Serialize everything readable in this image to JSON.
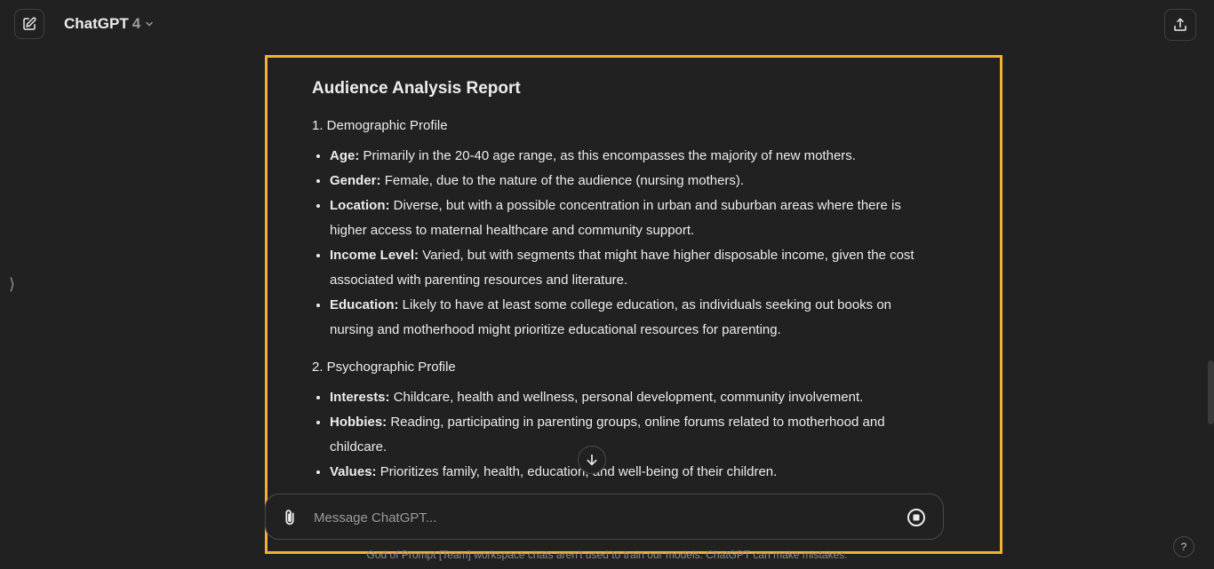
{
  "header": {
    "model_name": "ChatGPT",
    "model_version": "4"
  },
  "icons": {
    "new_chat": "pencil-square-icon",
    "model_dropdown": "chevron-down-icon",
    "share": "share-upload-icon",
    "sidebar_toggle": "chevron-right-icon",
    "scroll_down": "arrow-down-icon",
    "attach": "paperclip-icon",
    "stop": "stop-circle-icon"
  },
  "sidebar_toggle_glyph": "⟩",
  "report": {
    "title": "Audience Analysis Report",
    "sections": [
      {
        "heading": "1. Demographic Profile",
        "items": [
          {
            "label": "Age:",
            "text": "Primarily in the 20-40 age range, as this encompasses the majority of new mothers."
          },
          {
            "label": "Gender:",
            "text": "Female, due to the nature of the audience (nursing mothers)."
          },
          {
            "label": "Location:",
            "text": "Diverse, but with a possible concentration in urban and suburban areas where there is higher access to maternal healthcare and community support."
          },
          {
            "label": "Income Level:",
            "text": "Varied, but with segments that might have higher disposable income, given the cost associated with parenting resources and literature."
          },
          {
            "label": "Education:",
            "text": "Likely to have at least some college education, as individuals seeking out books on nursing and motherhood might prioritize educational resources for parenting."
          }
        ]
      },
      {
        "heading": "2. Psychographic Profile",
        "items": [
          {
            "label": "Interests:",
            "text": "Childcare, health and wellness, personal development, community involvement."
          },
          {
            "label": "Hobbies:",
            "text": "Reading, participating in parenting groups, online forums related to motherhood and childcare."
          },
          {
            "label": "Values:",
            "text": "Prioritizes family, health, education, and well-being of their children."
          }
        ]
      }
    ]
  },
  "composer": {
    "placeholder": "Message ChatGPT..."
  },
  "footer": {
    "note": "God of Prompt [Team] workspace chats aren't used to train our models. ChatGPT can make mistakes.",
    "help_label": "?"
  },
  "colors": {
    "background": "#212121",
    "highlight": "#f2b134",
    "text": "#ececec",
    "muted": "#9b9b9b"
  }
}
